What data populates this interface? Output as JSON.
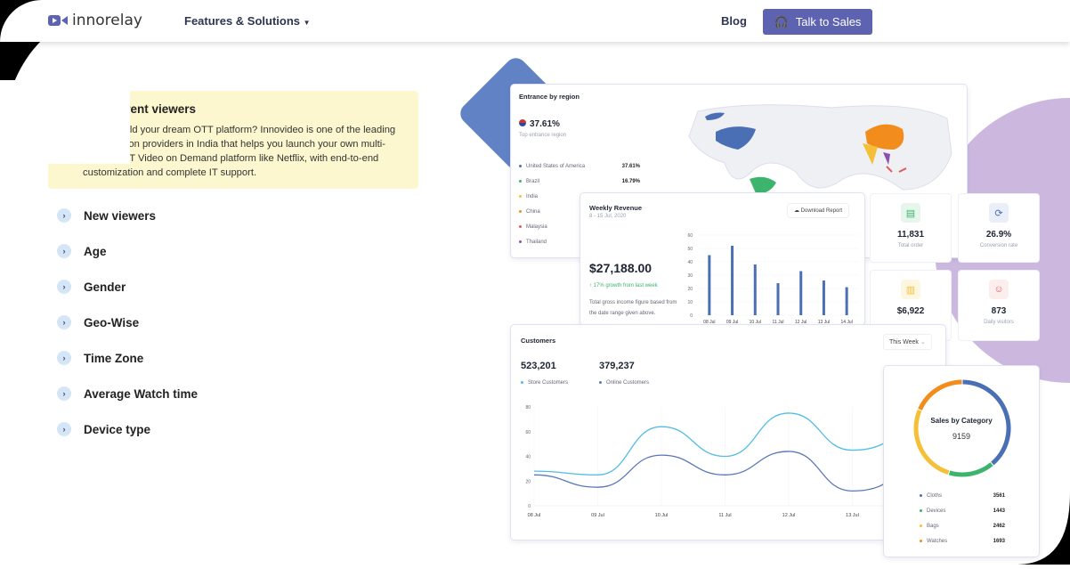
{
  "header": {
    "logo": "innorelay",
    "nav_features": "Features & Solutions",
    "nav_blog": "Blog",
    "cta": "Talk to Sales"
  },
  "accordion": {
    "open": {
      "title": "Concurrent viewers",
      "body": "How to build your dream OTT platform? Innovideo is one of the leading OTT solution providers in India that helps you launch your own multi-screen OTT Video on Demand platform like Netflix, with end-to-end customization and complete IT support."
    },
    "items": [
      "New viewers",
      "Age",
      "Gender",
      "Geo-Wise",
      "Time Zone",
      "Average Watch time",
      "Device type"
    ]
  },
  "region": {
    "title": "Entrance by region",
    "top_value": "37.61%",
    "top_label": "Top entrance region",
    "list": [
      {
        "name": "United States of America",
        "value": "37.61%",
        "color": "#4a6fb5"
      },
      {
        "name": "Brazil",
        "value": "16.79%",
        "color": "#3db46d"
      },
      {
        "name": "India",
        "value": "",
        "color": "#f5c038"
      },
      {
        "name": "China",
        "value": "",
        "color": "#f28c1d"
      },
      {
        "name": "Malaysia",
        "value": "",
        "color": "#e55b5b"
      },
      {
        "name": "Thailand",
        "value": "",
        "color": "#8a4fb0"
      }
    ]
  },
  "revenue": {
    "title": "Weekly Revenue",
    "dates": "8 - 15 Jul, 2020",
    "download": "Download Report",
    "amount": "$27,188.00",
    "growth": "17% growth from last week",
    "desc": "Total gross income figure based from the date range given above."
  },
  "stats": [
    {
      "value": "11,831",
      "label": "Total order",
      "color": "#3db46d",
      "bg": "#e6f6ec",
      "icon": "▤"
    },
    {
      "value": "26.9%",
      "label": "Conversion rate",
      "color": "#4a6fb5",
      "bg": "#e9eef9",
      "icon": "⟳"
    },
    {
      "value": "$6,922",
      "label": "",
      "color": "#f5c038",
      "bg": "#fdf6e0",
      "icon": "▥"
    },
    {
      "value": "873",
      "label": "Daily visitors",
      "color": "#e55b5b",
      "bg": "#fdeeee",
      "icon": "☺"
    }
  ],
  "customers": {
    "title": "Customers",
    "period": "This Week",
    "store_value": "523,201",
    "store_label": "Store Customers",
    "online_value": "379,237",
    "online_label": "Online Customers"
  },
  "sales": {
    "title": "Sales by Category",
    "total": "9159"
  },
  "chart_data": [
    {
      "type": "bar",
      "title": "Weekly Revenue",
      "categories": [
        "08 Jul",
        "09 Jul",
        "10 Jul",
        "11 Jul",
        "12 Jul",
        "13 Jul",
        "14 Jul"
      ],
      "values": [
        45,
        52,
        38,
        24,
        33,
        26,
        21
      ],
      "ylim": [
        0,
        60
      ],
      "yticks": [
        0,
        10,
        20,
        30,
        40,
        50,
        60
      ],
      "color": "#4a6fb5"
    },
    {
      "type": "line",
      "title": "Customers",
      "x": [
        "08 Jul",
        "09 Jul",
        "10 Jul",
        "11 Jul",
        "12 Jul",
        "13 Jul"
      ],
      "ylim": [
        0,
        80
      ],
      "yticks": [
        0,
        20,
        40,
        60,
        80
      ],
      "series": [
        {
          "name": "Store Customers",
          "values": [
            28,
            25,
            64,
            40,
            75,
            45
          ],
          "color": "#52bde6"
        },
        {
          "name": "Online Customers",
          "values": [
            25,
            15,
            41,
            25,
            44,
            12
          ],
          "color": "#5a78b8"
        }
      ]
    },
    {
      "type": "pie",
      "title": "Sales by Category",
      "categories": [
        "Cloths",
        "Devices",
        "Bags",
        "Watches"
      ],
      "values": [
        3561,
        1443,
        2462,
        1693
      ],
      "colors": [
        "#4a6fb5",
        "#3db46d",
        "#f5c038",
        "#f28c1d"
      ]
    }
  ]
}
